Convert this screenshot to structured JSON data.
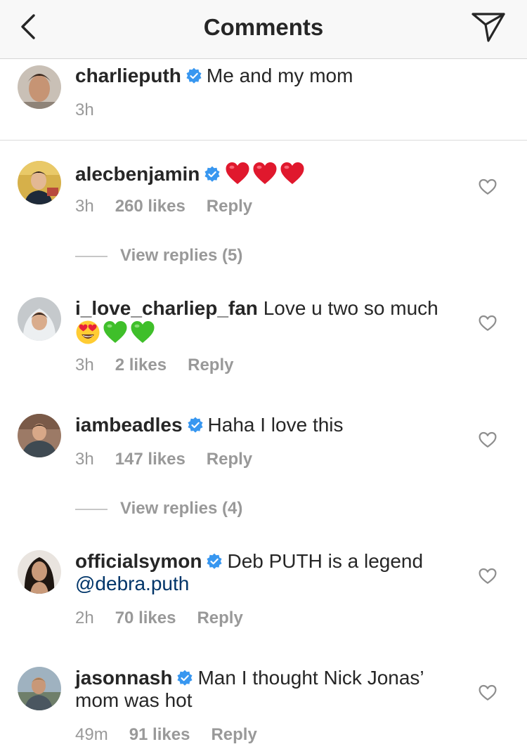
{
  "header": {
    "title": "Comments",
    "back_icon": "chevron-left-icon",
    "share_icon": "direct-send-icon"
  },
  "caption": {
    "username": "charlieputh",
    "verified": true,
    "text": "Me and my mom",
    "time": "3h"
  },
  "comments": [
    {
      "username": "alecbenjamin",
      "verified": true,
      "text": "",
      "emojis": [
        "red-heart",
        "red-heart",
        "red-heart"
      ],
      "time": "3h",
      "likes": "260 likes",
      "reply": "Reply",
      "view_replies": "View replies (5)"
    },
    {
      "username": "i_love_charliep_fan",
      "verified": false,
      "text": "Love u two so much",
      "emojis": [
        "heart-eyes",
        "green-heart",
        "green-heart"
      ],
      "time": "3h",
      "likes": "2 likes",
      "reply": "Reply"
    },
    {
      "username": "iambeadles",
      "verified": true,
      "text": "Haha I love this",
      "time": "3h",
      "likes": "147 likes",
      "reply": "Reply",
      "view_replies": "View replies (4)"
    },
    {
      "username": "officialsymon",
      "verified": true,
      "text": "Deb PUTH is a legend",
      "mention": "@debra.puth",
      "time": "2h",
      "likes": "70 likes",
      "reply": "Reply"
    },
    {
      "username": "jasonnash",
      "verified": true,
      "text": "Man I thought Nick Jonas’ mom was hot",
      "time": "49m",
      "likes": "91 likes",
      "reply": "Reply"
    }
  ],
  "colors": {
    "verified_blue": "#3897f0",
    "mention_blue": "#003569",
    "meta_gray": "#999999",
    "heart_red": "#e0182d",
    "green_heart": "#3fbf2a"
  }
}
